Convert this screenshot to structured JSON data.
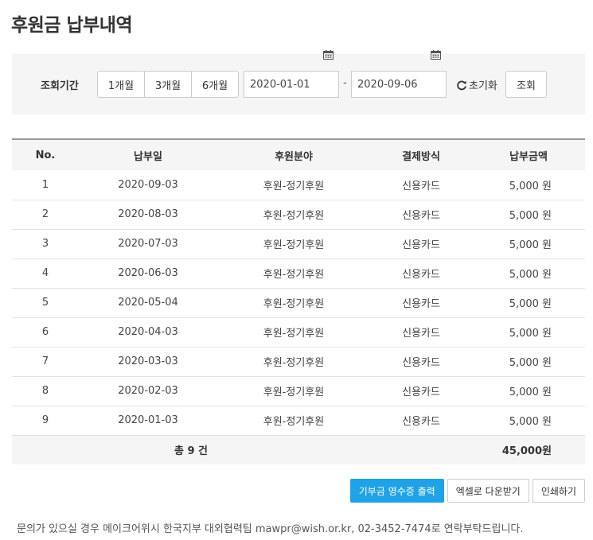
{
  "page": {
    "title": "후원금 납부내역"
  },
  "search": {
    "label": "조회기간",
    "periods": [
      "1개월",
      "3개월",
      "6개월"
    ],
    "date_from": "2020-01-01",
    "date_to": "2020-09-06",
    "separator": "-",
    "reset_label": "초기화",
    "query_label": "조회"
  },
  "table": {
    "headers": {
      "no": "No.",
      "date": "납부일",
      "category": "후원분야",
      "method": "결제방식",
      "amount": "납부금액"
    },
    "rows": [
      {
        "no": "1",
        "date": "2020-09-03",
        "category": "후원-정기후원",
        "method": "신용카드",
        "amount": "5,000 원"
      },
      {
        "no": "2",
        "date": "2020-08-03",
        "category": "후원-정기후원",
        "method": "신용카드",
        "amount": "5,000 원"
      },
      {
        "no": "3",
        "date": "2020-07-03",
        "category": "후원-정기후원",
        "method": "신용카드",
        "amount": "5,000 원"
      },
      {
        "no": "4",
        "date": "2020-06-03",
        "category": "후원-정기후원",
        "method": "신용카드",
        "amount": "5,000 원"
      },
      {
        "no": "5",
        "date": "2020-05-04",
        "category": "후원-정기후원",
        "method": "신용카드",
        "amount": "5,000 원"
      },
      {
        "no": "6",
        "date": "2020-04-03",
        "category": "후원-정기후원",
        "method": "신용카드",
        "amount": "5,000 원"
      },
      {
        "no": "7",
        "date": "2020-03-03",
        "category": "후원-정기후원",
        "method": "신용카드",
        "amount": "5,000 원"
      },
      {
        "no": "8",
        "date": "2020-02-03",
        "category": "후원-정기후원",
        "method": "신용카드",
        "amount": "5,000 원"
      },
      {
        "no": "9",
        "date": "2020-01-03",
        "category": "후원-정기후원",
        "method": "신용카드",
        "amount": "5,000 원"
      }
    ],
    "total": {
      "count_label": "총 9 건",
      "amount": "45,000원"
    }
  },
  "actions": {
    "receipt_label": "기부금 영수증 출력",
    "excel_label": "엑셀로 다운받기",
    "print_label": "인쇄하기"
  },
  "footer": {
    "note": "문의가 있으실 경우 메이크어위시 한국지부 대외협력팀 mawpr@wish.or.kr, 02-3452-7474로 연락부탁드립니다."
  },
  "colors": {
    "primary": "#1fa3e6",
    "panel_bg": "#f5f5f5",
    "table_top_border": "#999999"
  },
  "icons": {
    "calendar": "calendar-icon",
    "reset": "refresh-icon"
  }
}
